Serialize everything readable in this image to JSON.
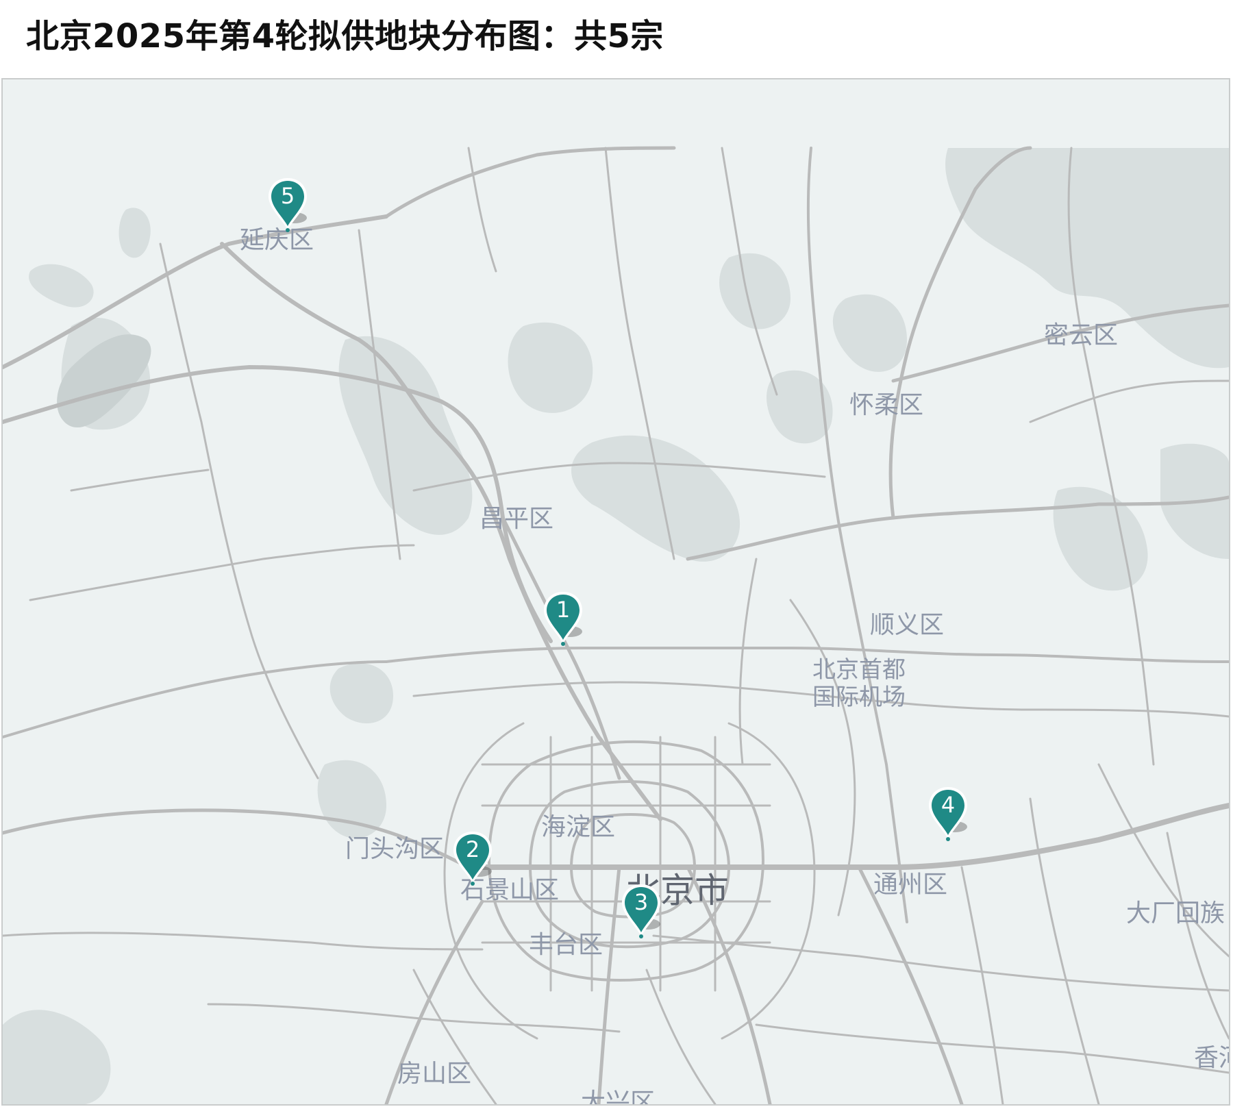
{
  "title": "北京2025年第4轮拟供地块分布图：共5宗",
  "map": {
    "place_labels": [
      {
        "id": "yanqing",
        "text": "延庆区"
      },
      {
        "id": "miyun",
        "text": "密云区"
      },
      {
        "id": "huairou",
        "text": "怀柔区"
      },
      {
        "id": "changping",
        "text": "昌平区"
      },
      {
        "id": "shunyi",
        "text": "顺义区"
      },
      {
        "id": "airport",
        "text": "北京首都国际机场"
      },
      {
        "id": "haidian",
        "text": "海淀区"
      },
      {
        "id": "mentougou",
        "text": "门头沟区"
      },
      {
        "id": "shijingshan",
        "text": "石景山区"
      },
      {
        "id": "beijing",
        "text": "北京市"
      },
      {
        "id": "tongzhou",
        "text": "通州区"
      },
      {
        "id": "dachang",
        "text": "大厂回族"
      },
      {
        "id": "fengtai",
        "text": "丰台区"
      },
      {
        "id": "fangshan",
        "text": "房山区"
      },
      {
        "id": "daxing",
        "text": "大兴区"
      },
      {
        "id": "xianghe",
        "text": "香河"
      }
    ],
    "markers": [
      {
        "id": "m1",
        "label": "1"
      },
      {
        "id": "m2",
        "label": "2"
      },
      {
        "id": "m3",
        "label": "3"
      },
      {
        "id": "m4",
        "label": "4"
      },
      {
        "id": "m5",
        "label": "5"
      }
    ],
    "colors": {
      "background": "#edf2f2",
      "terrain": "#d8dfdf",
      "road": "#b9baba",
      "marker": "#1f8a86",
      "label": "#8e97a8"
    }
  }
}
